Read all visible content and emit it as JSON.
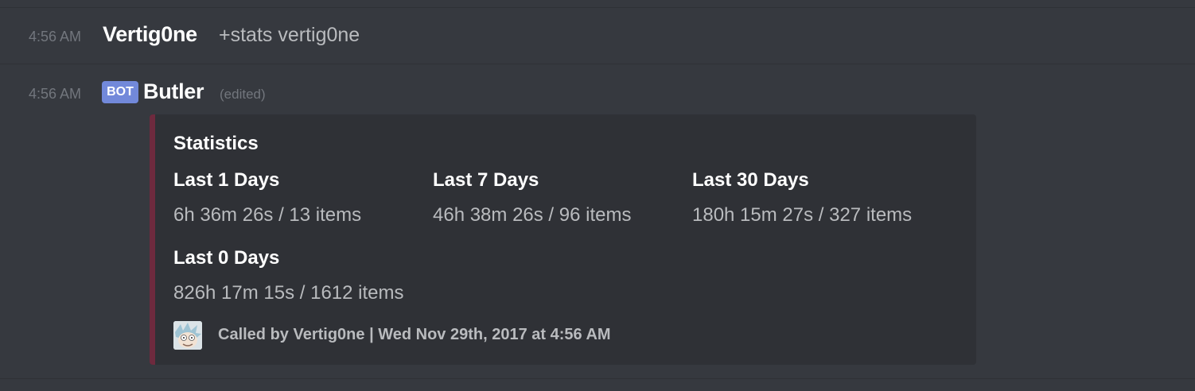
{
  "messages": [
    {
      "time": "4:56 AM",
      "author": "Vertig0ne",
      "content": "+stats vertig0ne"
    },
    {
      "time": "4:56 AM",
      "bot_tag": "BOT",
      "author": "Butler",
      "edited": "(edited)"
    }
  ],
  "embed": {
    "accent_color": "#6e2a3e",
    "title": "Statistics",
    "fields": [
      {
        "name": "Last 1 Days",
        "value": "6h 36m 26s  / 13 items"
      },
      {
        "name": "Last 7 Days",
        "value": "46h 38m 26s  / 96 items"
      },
      {
        "name": "Last 30 Days",
        "value": "180h 15m 27s  / 327 items"
      },
      {
        "name": "Last 0 Days",
        "value": "826h 17m 15s  / 1612 items"
      }
    ],
    "footer": {
      "icon": "user-avatar",
      "text": "Called by Vertig0ne | Wed Nov 29th, 2017 at 4:56 AM"
    }
  },
  "colors": {
    "background": "#36393f",
    "embed_background": "#2f3136",
    "bot_tag": "#7289da"
  }
}
